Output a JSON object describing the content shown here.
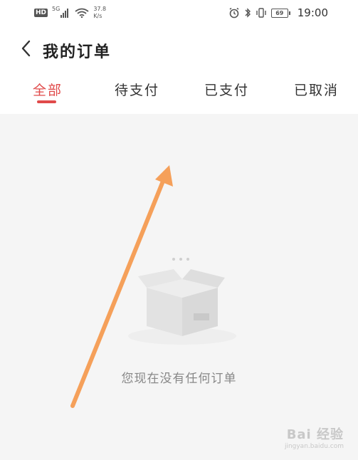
{
  "status_bar": {
    "hd": "HD",
    "network_gen": "5G",
    "speed_value": "37.8",
    "speed_unit": "K/s",
    "battery": "69",
    "time": "19:00"
  },
  "header": {
    "title": "我的订单"
  },
  "tabs": [
    {
      "label": "全部",
      "active": true
    },
    {
      "label": "待支付",
      "active": false
    },
    {
      "label": "已支付",
      "active": false
    },
    {
      "label": "已取消",
      "active": false
    }
  ],
  "empty_state": {
    "message": "您现在没有任何订单"
  },
  "watermark": {
    "logo": "Bai 经验",
    "url": "jingyan.baidu.com"
  },
  "colors": {
    "accent": "#e04a4a",
    "annotation_arrow": "#f5a05a",
    "content_bg": "#f5f5f5"
  }
}
